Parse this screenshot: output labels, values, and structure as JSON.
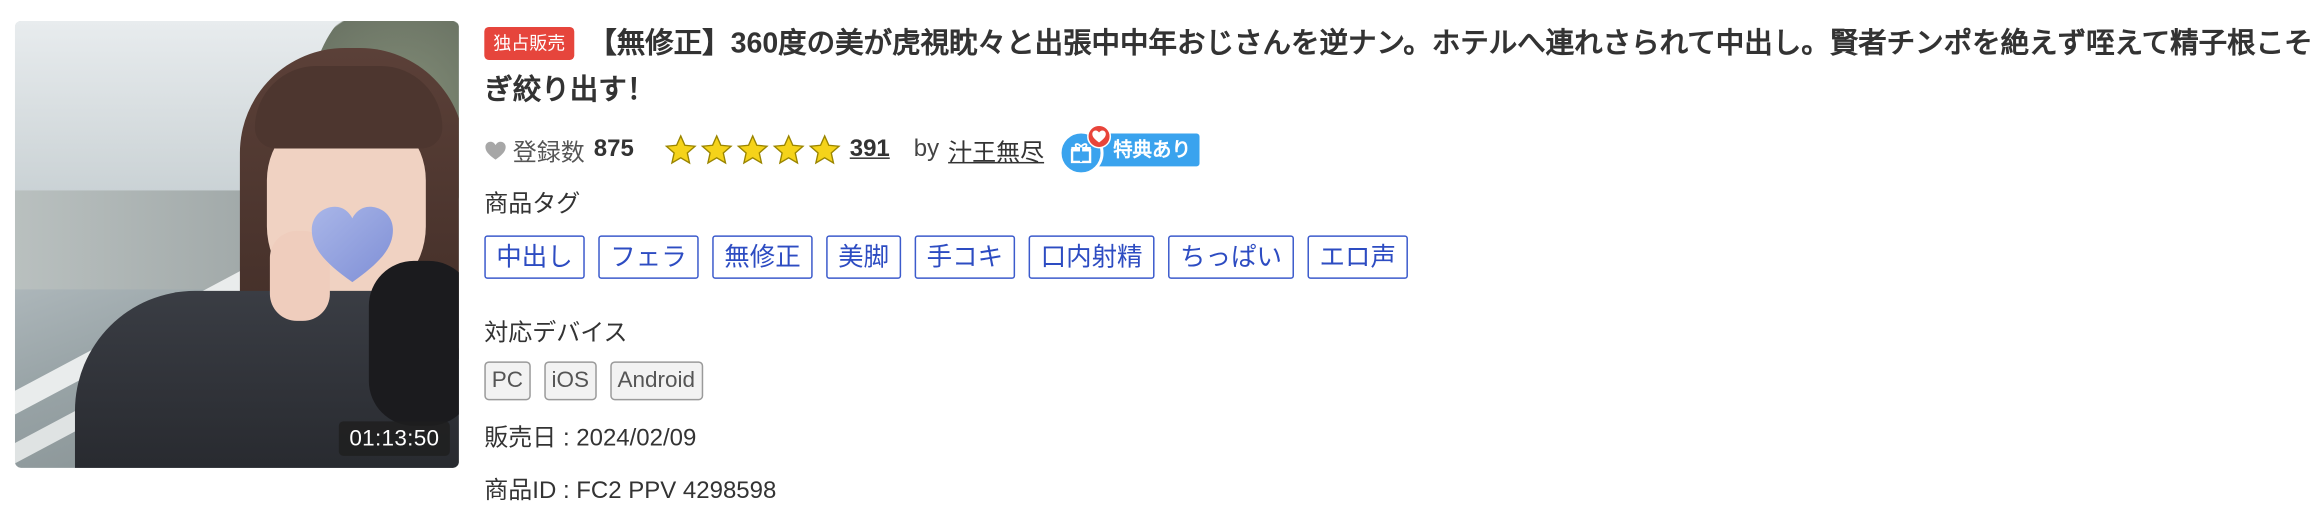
{
  "thumbnail": {
    "duration": "01:13:50"
  },
  "product": {
    "exclusive_badge": "独占販売",
    "title": "【無修正】360度の美が虎視眈々と出張中中年おじさんを逆ナン。ホテルへ連れさられて中出し。賢者チンポを絶えず咥えて精子根こそぎ絞り出す！",
    "registration_label": "登録数",
    "registration_count": "875",
    "rating_stars": 5,
    "review_count": "391",
    "by_label": "by",
    "author": "汁王無尽",
    "perk_label": "特典あり",
    "tags_label": "商品タグ",
    "tags": [
      "中出し",
      "フェラ",
      "無修正",
      "美脚",
      "手コキ",
      "口内射精",
      "ちっぱい",
      "エロ声"
    ],
    "devices_label": "対応デバイス",
    "devices": [
      "PC",
      "iOS",
      "Android"
    ],
    "release_date": "販売日 : 2024/02/09",
    "product_id": "商品ID : FC2 PPV 4298598"
  },
  "colors": {
    "exclusive_badge": "#e6453c",
    "tag_border": "#3c5bcc",
    "star": "#f5d31a",
    "perk_badge": "#3aa3ee"
  }
}
